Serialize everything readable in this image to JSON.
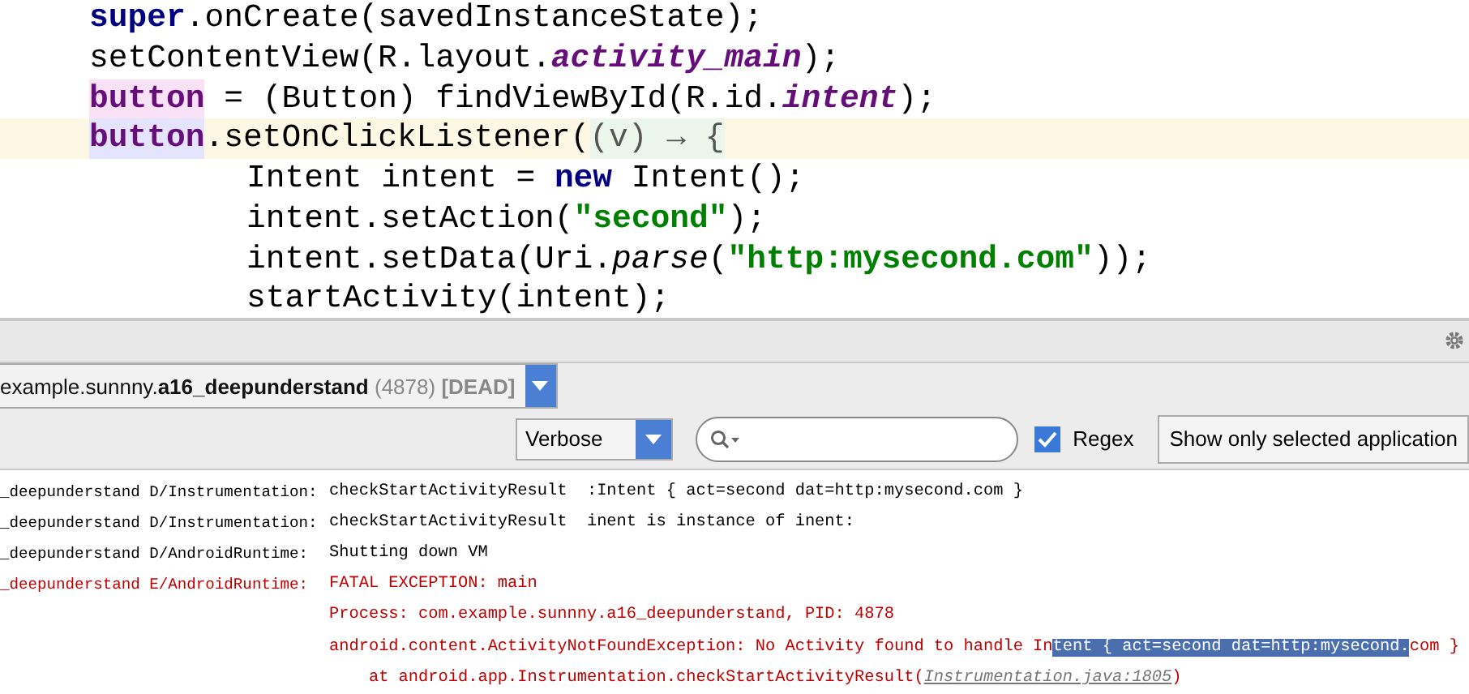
{
  "code": {
    "lines": [
      {
        "nested": false,
        "current": false,
        "tokens": [
          {
            "kind": "keyword",
            "text": "super"
          },
          {
            "kind": "plain",
            "text": ".onCreate(savedInstanceState);"
          }
        ]
      },
      {
        "nested": false,
        "current": false,
        "tokens": [
          {
            "kind": "plain",
            "text": "setContentView(R.layout."
          },
          {
            "kind": "static-field",
            "text": "activity_main"
          },
          {
            "kind": "plain",
            "text": ");"
          }
        ]
      },
      {
        "nested": false,
        "current": false,
        "tokens": [
          {
            "kind": "field-write",
            "text": "button"
          },
          {
            "kind": "plain",
            "text": " = (Button) findViewById(R.id."
          },
          {
            "kind": "static-field",
            "text": "intent"
          },
          {
            "kind": "plain",
            "text": ");"
          }
        ]
      },
      {
        "nested": false,
        "current": true,
        "tokens": [
          {
            "kind": "field-read",
            "text": "button"
          },
          {
            "kind": "plain",
            "text": ".setOnClickListener("
          },
          {
            "kind": "lambda",
            "text": "(v) → {"
          }
        ]
      },
      {
        "nested": true,
        "current": false,
        "tokens": [
          {
            "kind": "plain",
            "text": "Intent intent = "
          },
          {
            "kind": "keyword",
            "text": "new"
          },
          {
            "kind": "plain",
            "text": " Intent();"
          }
        ]
      },
      {
        "nested": true,
        "current": false,
        "tokens": [
          {
            "kind": "plain",
            "text": "intent.setAction("
          },
          {
            "kind": "string",
            "text": "\"second\""
          },
          {
            "kind": "plain",
            "text": ");"
          }
        ]
      },
      {
        "nested": true,
        "current": false,
        "tokens": [
          {
            "kind": "plain",
            "text": "intent.setData(Uri."
          },
          {
            "kind": "italic",
            "text": "parse"
          },
          {
            "kind": "plain",
            "text": "("
          },
          {
            "kind": "string",
            "text": "\"http:mysecond.com\""
          },
          {
            "kind": "plain",
            "text": "));"
          }
        ]
      },
      {
        "nested": true,
        "current": false,
        "tokens": [
          {
            "kind": "plain",
            "text": "startActivity(intent);"
          }
        ]
      }
    ]
  },
  "logcat": {
    "process": {
      "prefix": "example.sunnny.",
      "name": "a16_deepunderstand",
      "pid": "(4878)",
      "status": "[DEAD]"
    },
    "level": "Verbose",
    "regex": {
      "label": "Regex",
      "checked": true
    },
    "filter_button": "Show only selected application",
    "lines": [
      {
        "kind": "debug",
        "tag": "_deepunderstand D/Instrumentation:",
        "text": "checkStartActivityResult  :Intent { act=second dat=http:mysecond.com }"
      },
      {
        "kind": "debug",
        "tag": "_deepunderstand D/Instrumentation:",
        "text": "checkStartActivityResult  inent is instance of inent:"
      },
      {
        "kind": "debug",
        "tag": "_deepunderstand D/AndroidRuntime:",
        "text": "Shutting down VM"
      },
      {
        "kind": "error",
        "tag": "_deepunderstand E/AndroidRuntime:",
        "text": "FATAL EXCEPTION: main"
      },
      {
        "kind": "error",
        "text": "Process: com.example.sunnny.a16_deepunderstand, PID: 4878"
      },
      {
        "kind": "error",
        "text": "android.content.ActivityNotFoundException: No Activity found to handle In",
        "selected_text": "tent { act=second dat=http:mysecond.",
        "after": "com }"
      },
      {
        "kind": "error",
        "text": "    at android.app.Instrumentation.checkStartActivityResult(",
        "link": "Instrumentation.java:1805",
        "after": ")"
      }
    ]
  }
}
